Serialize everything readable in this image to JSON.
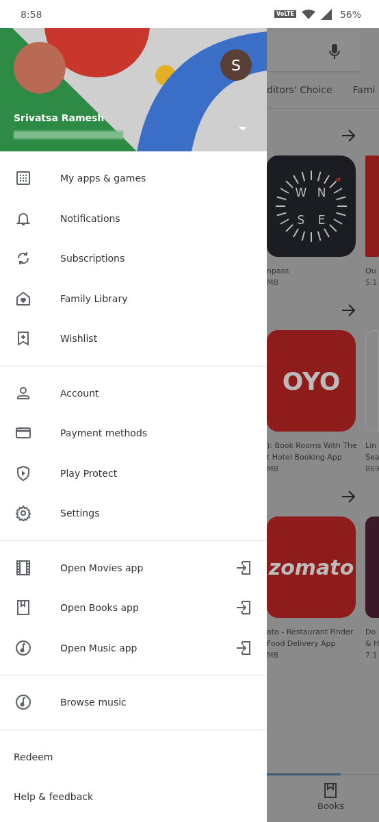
{
  "status_bar": {
    "time": "8:58",
    "network_badge": "VoLTE",
    "battery": "56%"
  },
  "account": {
    "name": "Srivatsa Ramesh",
    "initial": "S"
  },
  "menu_sections": [
    {
      "items": [
        {
          "label": "My apps & games",
          "kind": "grid"
        },
        {
          "label": "Notifications",
          "kind": "bell"
        },
        {
          "label": "Subscriptions",
          "kind": "sync"
        },
        {
          "label": "Family Library",
          "kind": "family"
        },
        {
          "label": "Wishlist",
          "kind": "wishlist"
        }
      ]
    },
    {
      "items": [
        {
          "label": "Account",
          "kind": "person"
        },
        {
          "label": "Payment methods",
          "kind": "card"
        },
        {
          "label": "Play Protect",
          "kind": "shield"
        },
        {
          "label": "Settings",
          "kind": "gear"
        }
      ]
    },
    {
      "items": [
        {
          "label": "Open Movies app",
          "kind": "film",
          "external": true
        },
        {
          "label": "Open Books app",
          "kind": "book",
          "external": true
        },
        {
          "label": "Open Music app",
          "kind": "music",
          "external": true
        }
      ]
    },
    {
      "items": [
        {
          "label": "Browse music",
          "kind": "music"
        }
      ]
    },
    {
      "items": [
        {
          "label": "Redeem",
          "kind": "text"
        },
        {
          "label": "Help & feedback",
          "kind": "text"
        }
      ]
    }
  ],
  "background": {
    "tabs": [
      "ditors' Choice",
      "Fami"
    ],
    "sections": [
      {
        "apps": [
          {
            "kind": "compass",
            "logo": [
              "W",
              "N",
              "S",
              "E"
            ],
            "title_lines": [
              "npass"
            ],
            "size": "MB"
          },
          {
            "kind": "plain",
            "title_lines": [
              "Qu"
            ],
            "size": "5.1"
          }
        ]
      },
      {
        "apps": [
          {
            "kind": "logo",
            "logo": [
              "OYO"
            ],
            "title_lines": [
              "): Book Rooms With The",
              "t Hotel Booking App"
            ],
            "size": "MB"
          },
          {
            "kind": "outline",
            "title_lines": [
              "Lin",
              "Sea"
            ],
            "size": "869"
          }
        ]
      },
      {
        "apps": [
          {
            "kind": "logo",
            "logo": [
              "zomato"
            ],
            "title_lines": [
              "ato - Restaurant Finder",
              "Food Delivery App"
            ],
            "size": "MB"
          },
          {
            "kind": "dark",
            "title_lines": [
              "Do",
              "& H"
            ],
            "size": "7.1"
          }
        ]
      }
    ],
    "bottom_nav": {
      "label": "Books"
    }
  }
}
